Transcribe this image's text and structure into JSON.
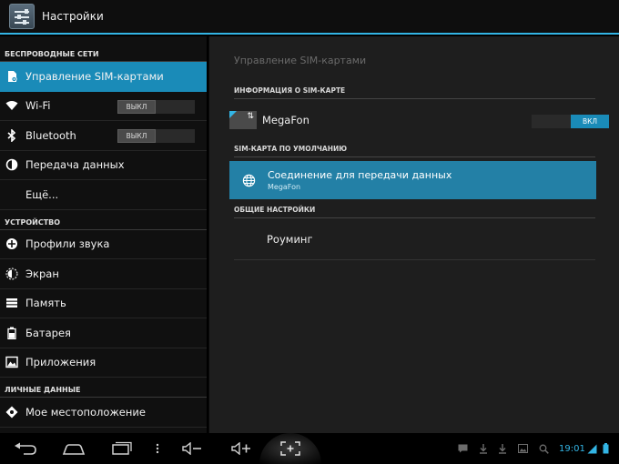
{
  "app": {
    "title": "Настройки"
  },
  "left": {
    "sections": {
      "wireless": "БЕСПРОВОДНЫЕ СЕТИ",
      "device": "УСТРОЙСТВО",
      "personal": "ЛИЧНЫЕ ДАННЫЕ"
    },
    "items": [
      {
        "label": "Управление SIM-картами",
        "icon": "sim-icon",
        "selected": true
      },
      {
        "label": "Wi-Fi",
        "icon": "wifi-icon",
        "toggle": "ВЫКЛ"
      },
      {
        "label": "Bluetooth",
        "icon": "bluetooth-icon",
        "toggle": "ВЫКЛ"
      },
      {
        "label": "Передача данных",
        "icon": "data-usage-icon"
      },
      {
        "label": "Ещё...",
        "icon": ""
      },
      {
        "label": "Профили звука",
        "icon": "sound-profile-icon"
      },
      {
        "label": "Экран",
        "icon": "display-icon"
      },
      {
        "label": "Память",
        "icon": "storage-icon"
      },
      {
        "label": "Батарея",
        "icon": "battery-icon"
      },
      {
        "label": "Приложения",
        "icon": "apps-icon"
      },
      {
        "label": "Мое местоположение",
        "icon": "location-icon"
      }
    ]
  },
  "right": {
    "title": "Управление SIM-картами",
    "sim_info_header": "ИНФОРМАЦИЯ О SIM-КАРТЕ",
    "sim": {
      "name": "MegaFon",
      "toggle": "ВКЛ"
    },
    "default_sim_header": "SIM-КАРТА ПО УМОЛЧАНИЮ",
    "data_connection": {
      "title": "Соединение для передачи данных",
      "subtitle": "MegaFon"
    },
    "general_header": "ОБЩИЕ НАСТРОЙКИ",
    "roaming": "Роуминг"
  },
  "navbar": {
    "time": "19:01"
  },
  "colors": {
    "accent": "#33b5e5",
    "selected": "#1a8bb8",
    "data_row": "#2380a6"
  }
}
